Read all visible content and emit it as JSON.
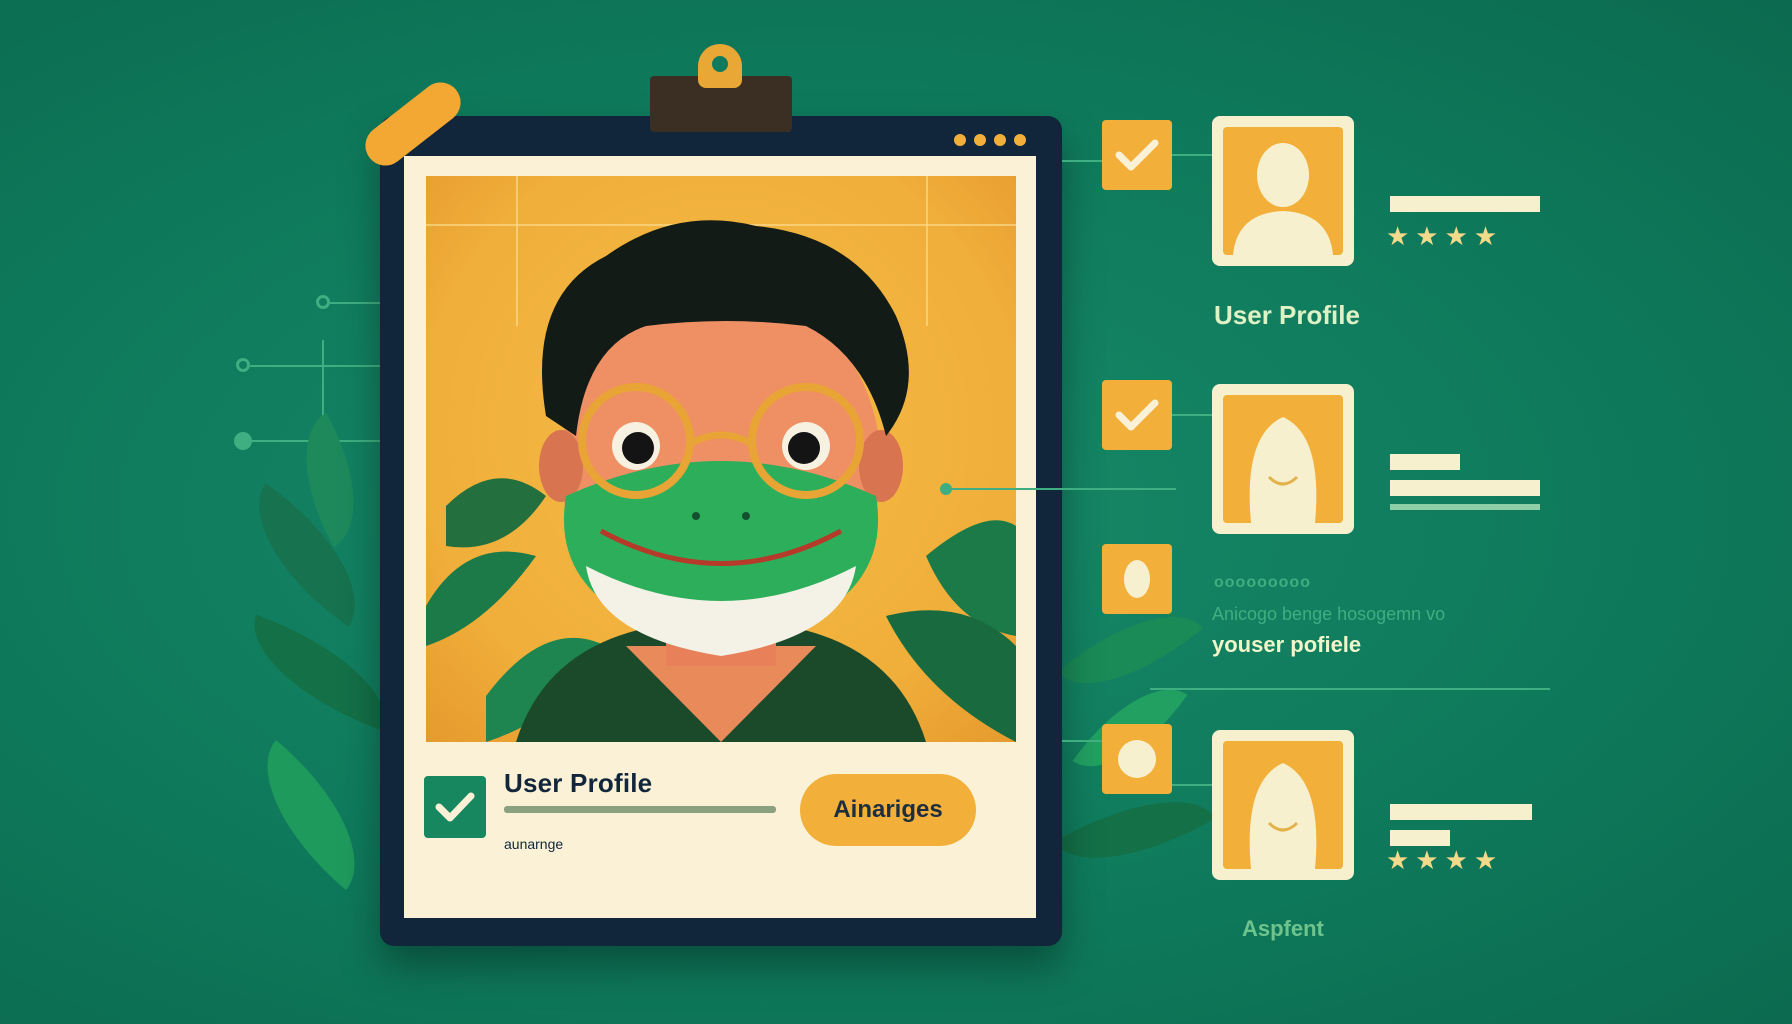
{
  "main_card": {
    "title": "User Profile",
    "subtitle": "aunarnge",
    "button_label": "Ainariges"
  },
  "profiles": [
    {
      "label": "User Profile",
      "rating_stars": "★★★★"
    },
    {
      "label": ""
    },
    {
      "caption_dots": "ooooooooo",
      "caption_line": "Anicogo benge hosogemn vo",
      "label": "youser pofiele"
    },
    {
      "rating_stars": "★★★★",
      "label": "Aspfent"
    }
  ],
  "colors": {
    "background": "#0f7b5c",
    "accent_yellow": "#f2b03a",
    "card_frame": "#11263a",
    "card_cream": "#fbf1d6",
    "check_green": "#17875f"
  },
  "icons": [
    "check-icon",
    "avatar-icon",
    "star-icon",
    "leaf-icon",
    "clip-icon"
  ]
}
